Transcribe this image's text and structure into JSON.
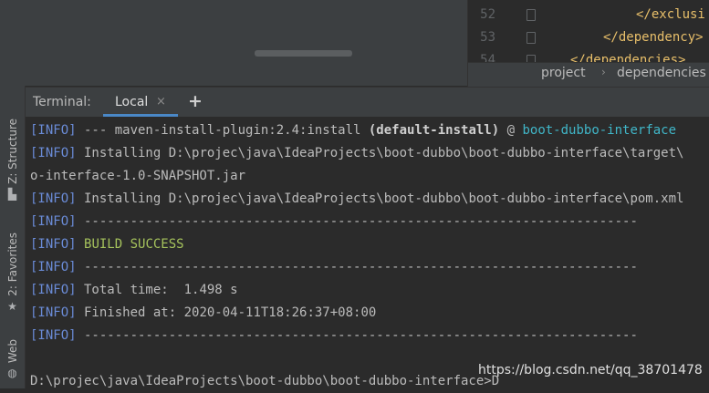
{
  "editor": {
    "lines": [
      {
        "num": "52",
        "code": "</exclusi"
      },
      {
        "num": "53",
        "code": "</dependency>"
      },
      {
        "num": "54",
        "code": "</dependencies>"
      }
    ]
  },
  "breadcrumb": [
    "project",
    "dependencies"
  ],
  "sidebar": {
    "structure_label": "Z: Structure",
    "favorites_label": "2: Favorites",
    "web_label": "Web"
  },
  "terminal": {
    "title": "Terminal:",
    "tab_label": "Local",
    "tab_close": "×",
    "new_tab": "+",
    "lines": [
      {
        "tag": "[INFO]",
        "text": " --- maven-install-plugin:2.4:install ",
        "bold": "(default-install)",
        "at": " @ ",
        "cyan": "boot-dubbo-interface"
      },
      {
        "tag": "[INFO]",
        "text": " Installing D:\\projec\\java\\IdeaProjects\\boot-dubbo\\boot-dubbo-interface\\target\\"
      },
      {
        "tag": "",
        "text": "o-interface-1.0-SNAPSHOT.jar"
      },
      {
        "tag": "[INFO]",
        "text": " Installing D:\\projec\\java\\IdeaProjects\\boot-dubbo\\boot-dubbo-interface\\pom.xml"
      },
      {
        "tag": "[INFO]",
        "text": " ------------------------------------------------------------------------"
      },
      {
        "tag": "[INFO]",
        "text": " ",
        "success": "BUILD SUCCESS"
      },
      {
        "tag": "[INFO]",
        "text": " ------------------------------------------------------------------------"
      },
      {
        "tag": "[INFO]",
        "text": " Total time:  1.498 s"
      },
      {
        "tag": "[INFO]",
        "text": " Finished at: 2020-04-11T18:26:37+08:00"
      },
      {
        "tag": "[INFO]",
        "text": " ------------------------------------------------------------------------"
      }
    ],
    "prompt": "D:\\projec\\java\\IdeaProjects\\boot-dubbo\\boot-dubbo-interface>D"
  },
  "watermark": "https://blog.csdn.net/qq_38701478"
}
